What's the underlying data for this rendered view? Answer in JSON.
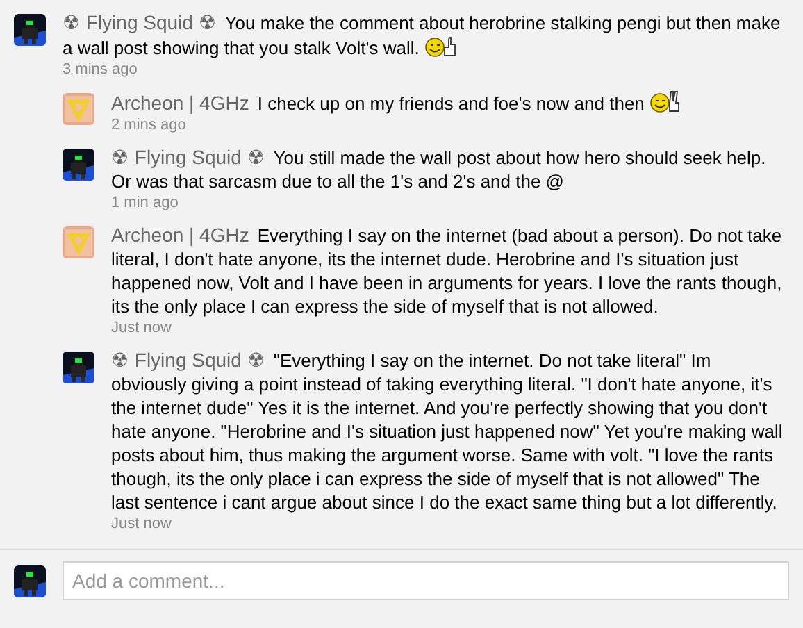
{
  "comments": [
    {
      "kind": "comment",
      "avatar": {
        "kind": "squid"
      },
      "author": "☢ Flying Squid ☢",
      "text": "You make the comment about herobrine stalking pengi but then make a wall post showing that you stalk Volt's wall.",
      "emoticon": {
        "kind": "thumbs-up"
      },
      "time": "3 mins ago"
    },
    {
      "kind": "reply",
      "avatar": {
        "kind": "archeon"
      },
      "author": "Archeon | 4GHz",
      "text": "I check up on my friends and foe's now and then",
      "emoticon": {
        "kind": "peace"
      },
      "time": "2 mins ago"
    },
    {
      "kind": "reply",
      "avatar": {
        "kind": "squid"
      },
      "author": "☢ Flying Squid ☢",
      "text": "You still made the wall post about how hero should seek help. Or was that sarcasm due to all the 1's and 2's and the @",
      "time": "1 min ago"
    },
    {
      "kind": "reply",
      "avatar": {
        "kind": "archeon"
      },
      "author": "Archeon | 4GHz",
      "text": "Everything I say on the internet (bad about a person). Do not take literal, I don't hate anyone, its the internet dude. Herobrine and I's situation just happened now, Volt and I have been in arguments for years. I love the rants though, its the only place I can express the side of myself that is not allowed.",
      "time": "Just now"
    },
    {
      "kind": "reply",
      "avatar": {
        "kind": "squid"
      },
      "author": "☢ Flying Squid ☢",
      "text": "\"Everything I say on the internet. Do not take literal\" Im obviously giving a point instead of taking everything literal. \"I don't hate anyone, it's the internet dude\" Yes it is the internet. And you're perfectly showing that you don't hate anyone. \"Herobrine and I's situation just happened now\" Yet you're making wall posts about him, thus making the argument worse. Same with volt. \"I love the rants though, its the only place i can express the side of myself that is not allowed\" The last sentence i cant argue about since I do the exact same thing but a lot differently.",
      "time": "Just now"
    }
  ],
  "composer": {
    "avatar": {
      "kind": "squid"
    },
    "placeholder": "Add a comment..."
  }
}
